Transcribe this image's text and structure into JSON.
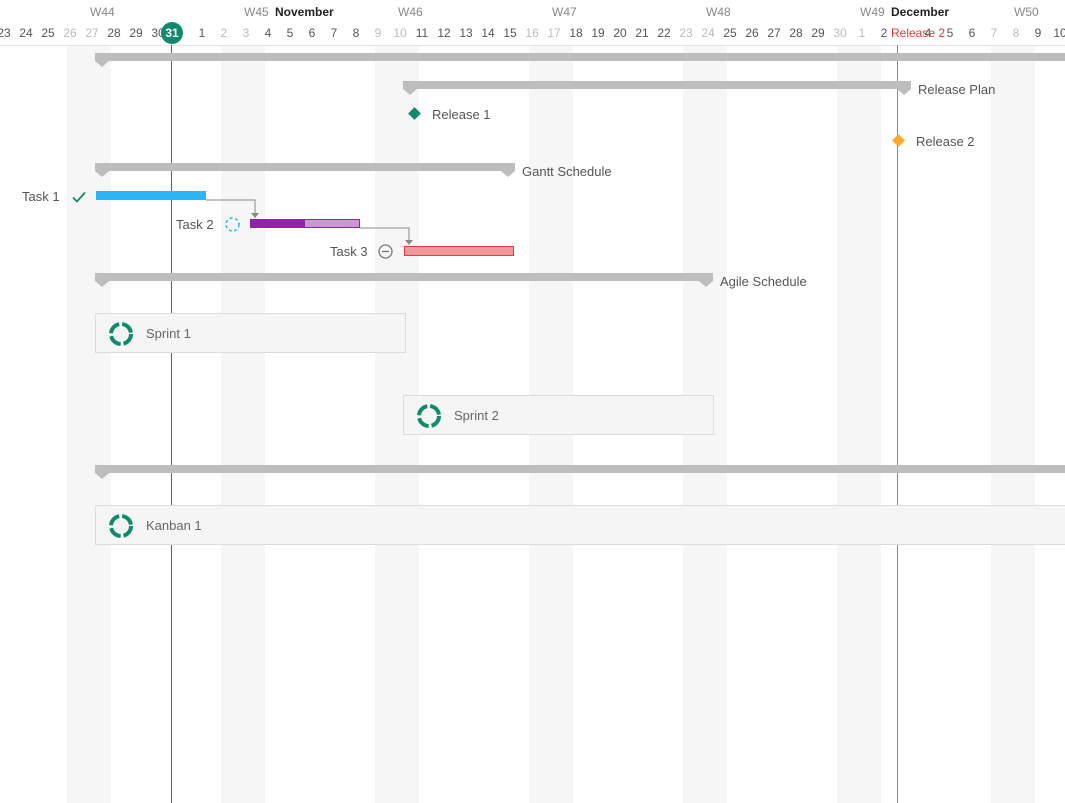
{
  "header": {
    "weeks": [
      "W44",
      "W45",
      "W46",
      "W47",
      "W48",
      "W49",
      "W50"
    ],
    "months": [
      "November",
      "December"
    ],
    "days": [
      "23",
      "24",
      "25",
      "26",
      "27",
      "28",
      "29",
      "30",
      "31",
      "1",
      "2",
      "3",
      "4",
      "5",
      "6",
      "7",
      "8",
      "9",
      "10",
      "11",
      "12",
      "13",
      "14",
      "15",
      "16",
      "17",
      "18",
      "19",
      "20",
      "21",
      "22",
      "23",
      "24",
      "25",
      "26",
      "27",
      "28",
      "29",
      "30",
      "1",
      "2",
      "3",
      "4",
      "5",
      "6",
      "7",
      "8",
      "9",
      "10"
    ],
    "today": "31",
    "release_marker": "Release 2"
  },
  "rows": {
    "release_plan": "Release Plan",
    "release1": "Release 1",
    "release2": "Release 2",
    "gantt_schedule": "Gantt Schedule",
    "task1": "Task 1",
    "task2": "Task 2",
    "task3": "Task 3",
    "agile_schedule": "Agile Schedule",
    "sprint1": "Sprint 1",
    "sprint2": "Sprint 2",
    "kanban1": "Kanban 1"
  },
  "task_progress": {
    "task1": 1.0,
    "task2": 0.5,
    "task3": 0.0
  },
  "colors": {
    "accent": "#0f8a6c",
    "today_line": "#0f8a6c",
    "release_line": "#e53935",
    "summary": "#bdbdbd",
    "task1": "#29b6f6",
    "task2_done": "#8e24aa",
    "task2_remaining": "#ce93d8",
    "task3": "#ef9a9a",
    "release1": "#0f8a6c",
    "release2": "#ffa726"
  },
  "icons": {
    "task1_status": "checkmark-icon",
    "task2_status": "dashed-circle-icon",
    "task3_status": "minus-circle-icon",
    "sprint": "cycle-icon"
  }
}
